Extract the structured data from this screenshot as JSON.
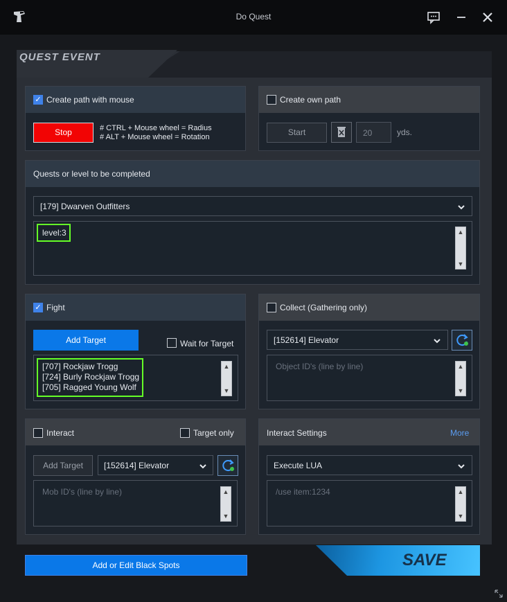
{
  "window": {
    "title": "Do Quest"
  },
  "header": {
    "title": "QUEST EVENT"
  },
  "path_mouse": {
    "label": "Create path with mouse",
    "checked": true,
    "stop_label": "Stop",
    "hint1": "# CTRL + Mouse wheel = Radius",
    "hint2": "# ALT + Mouse wheel = Rotation"
  },
  "own_path": {
    "label": "Create own path",
    "checked": false,
    "start_label": "Start",
    "distance_value": "20",
    "unit": "yds."
  },
  "quests": {
    "header": "Quests or level to be completed",
    "selected": "[179] Dwarven Outfitters",
    "text": "level:3"
  },
  "fight": {
    "label": "Fight",
    "checked": true,
    "add_target_label": "Add Target",
    "wait_label": "Wait for Target",
    "targets": [
      "[707] Rockjaw Trogg",
      "[724] Burly Rockjaw Trogg",
      "[705] Ragged Young Wolf"
    ]
  },
  "collect": {
    "label": "Collect (Gathering only)",
    "selected": "[152614] Elevator",
    "placeholder": "Object ID's (line by line)"
  },
  "interact": {
    "label": "Interact",
    "target_only_label": "Target only",
    "add_target_label": "Add Target",
    "selected": "[152614] Elevator",
    "placeholder": "Mob ID's (line by line)"
  },
  "interact_settings": {
    "header": "Interact Settings",
    "more_label": "More",
    "selected": "Execute LUA",
    "placeholder": "/use item:1234"
  },
  "footer": {
    "black_spots_label": "Add or Edit Black Spots",
    "save_label": "SAVE"
  },
  "colors": {
    "accent_blue": "#0a78e8",
    "stop_red": "#f20404",
    "highlight_green": "#65ff27"
  }
}
